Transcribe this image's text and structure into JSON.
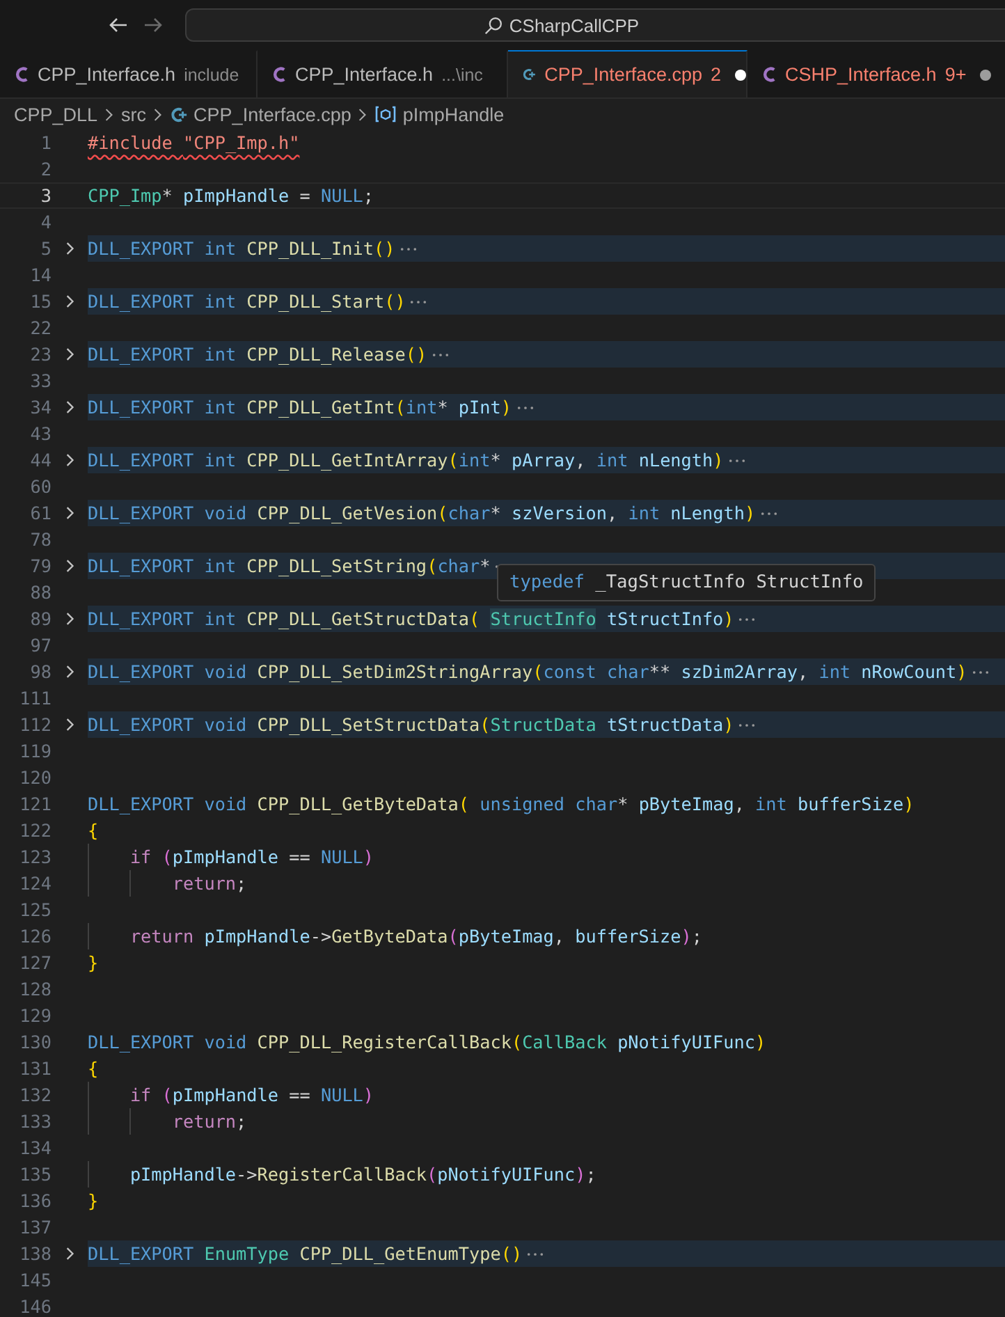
{
  "title_bar": {
    "back": {
      "disabled": false
    },
    "forward": {
      "disabled": true
    },
    "search": "CSharpCallCPP"
  },
  "tabs": [
    {
      "kind": "c",
      "label": "CPP_Interface.h",
      "detail": "include",
      "selected": false,
      "error": false,
      "modified": false
    },
    {
      "kind": "c",
      "label": "CPP_Interface.h",
      "detail": "...\\inc",
      "selected": false,
      "error": false,
      "modified": false
    },
    {
      "kind": "cpp",
      "label": "CPP_Interface.cpp",
      "badge": "2",
      "selected": true,
      "error": true,
      "modified": true
    },
    {
      "kind": "c",
      "label": "CSHP_Interface.h",
      "badge": "9+",
      "selected": false,
      "error": true,
      "modified": true
    }
  ],
  "breadcrumb": [
    {
      "kind": "folder",
      "label": "CPP_DLL"
    },
    {
      "kind": "folder",
      "label": "src"
    },
    {
      "kind": "cpp",
      "label": "CPP_Interface.cpp"
    },
    {
      "kind": "variable",
      "label": "pImpHandle"
    }
  ],
  "lines": [
    {
      "n": "1",
      "current": false,
      "folded": false,
      "tokens": [
        {
          "t": "#include ",
          "kind": "directive-error"
        },
        {
          "t": "\"CPP_Imp.h\"",
          "kind": "string-error"
        }
      ]
    },
    {
      "n": "2",
      "current": false,
      "folded": false
    },
    {
      "n": "3",
      "current": true,
      "folded": false,
      "tokens": [
        {
          "t": "CPP_Imp",
          "kind": "type"
        },
        {
          "t": "* ",
          "kind": "punct"
        },
        {
          "t": "pImpHandle",
          "kind": "variable"
        },
        {
          "t": " = ",
          "kind": "punct"
        },
        {
          "t": "NULL",
          "kind": "keyword"
        },
        {
          "t": ";",
          "kind": "punct"
        }
      ]
    },
    {
      "n": "4",
      "current": false,
      "folded": false
    },
    {
      "n": "5",
      "current": false,
      "folded": true,
      "tokens": [
        {
          "t": "DLL_EXPORT ",
          "kind": "macro"
        },
        {
          "t": "int ",
          "kind": "keyword"
        },
        {
          "t": "CPP_DLL_Init",
          "kind": "function"
        },
        {
          "t": "()",
          "kind": "bracket"
        }
      ]
    },
    {
      "n": "14",
      "current": false,
      "folded": false
    },
    {
      "n": "15",
      "current": false,
      "folded": true,
      "tokens": [
        {
          "t": "DLL_EXPORT ",
          "kind": "macro"
        },
        {
          "t": "int ",
          "kind": "keyword"
        },
        {
          "t": "CPP_DLL_Start",
          "kind": "function"
        },
        {
          "t": "()",
          "kind": "bracket"
        }
      ]
    },
    {
      "n": "22",
      "current": false,
      "folded": false
    },
    {
      "n": "23",
      "current": false,
      "folded": true,
      "tokens": [
        {
          "t": "DLL_EXPORT ",
          "kind": "macro"
        },
        {
          "t": "int ",
          "kind": "keyword"
        },
        {
          "t": "CPP_DLL_Release",
          "kind": "function"
        },
        {
          "t": "()",
          "kind": "bracket"
        }
      ]
    },
    {
      "n": "33",
      "current": false,
      "folded": false
    },
    {
      "n": "34",
      "current": false,
      "folded": true,
      "tokens": [
        {
          "t": "DLL_EXPORT ",
          "kind": "macro"
        },
        {
          "t": "int ",
          "kind": "keyword"
        },
        {
          "t": "CPP_DLL_GetInt",
          "kind": "function"
        },
        {
          "t": "(",
          "kind": "bracket"
        },
        {
          "t": "int",
          "kind": "keyword"
        },
        {
          "t": "* ",
          "kind": "punct"
        },
        {
          "t": "pInt",
          "kind": "variable"
        },
        {
          "t": ")",
          "kind": "bracket"
        }
      ]
    },
    {
      "n": "43",
      "current": false,
      "folded": false
    },
    {
      "n": "44",
      "current": false,
      "folded": true,
      "tokens": [
        {
          "t": "DLL_EXPORT ",
          "kind": "macro"
        },
        {
          "t": "int ",
          "kind": "keyword"
        },
        {
          "t": "CPP_DLL_GetIntArray",
          "kind": "function"
        },
        {
          "t": "(",
          "kind": "bracket"
        },
        {
          "t": "int",
          "kind": "keyword"
        },
        {
          "t": "* ",
          "kind": "punct"
        },
        {
          "t": "pArray",
          "kind": "variable"
        },
        {
          "t": ", ",
          "kind": "punct"
        },
        {
          "t": "int ",
          "kind": "keyword"
        },
        {
          "t": "nLength",
          "kind": "variable"
        },
        {
          "t": ")",
          "kind": "bracket"
        }
      ]
    },
    {
      "n": "60",
      "current": false,
      "folded": false
    },
    {
      "n": "61",
      "current": false,
      "folded": true,
      "tokens": [
        {
          "t": "DLL_EXPORT ",
          "kind": "macro"
        },
        {
          "t": "void ",
          "kind": "keyword"
        },
        {
          "t": "CPP_DLL_GetVesion",
          "kind": "function"
        },
        {
          "t": "(",
          "kind": "bracket"
        },
        {
          "t": "char",
          "kind": "keyword"
        },
        {
          "t": "* ",
          "kind": "punct"
        },
        {
          "t": "szVersion",
          "kind": "variable"
        },
        {
          "t": ", ",
          "kind": "punct"
        },
        {
          "t": "int ",
          "kind": "keyword"
        },
        {
          "t": "nLength",
          "kind": "variable"
        },
        {
          "t": ")",
          "kind": "bracket"
        }
      ]
    },
    {
      "n": "78",
      "current": false,
      "folded": false
    },
    {
      "n": "79",
      "current": false,
      "folded": true,
      "tokens": [
        {
          "t": "DLL_EXPORT ",
          "kind": "macro"
        },
        {
          "t": "int ",
          "kind": "keyword"
        },
        {
          "t": "CPP_DLL_SetString",
          "kind": "function"
        },
        {
          "t": "(",
          "kind": "bracket"
        },
        {
          "t": "char",
          "kind": "keyword"
        },
        {
          "t": "*",
          "kind": "punct"
        }
      ]
    },
    {
      "n": "88",
      "current": false,
      "folded": false
    },
    {
      "n": "89",
      "current": false,
      "folded": true,
      "tokens": [
        {
          "t": "DLL_EXPORT ",
          "kind": "macro"
        },
        {
          "t": "int ",
          "kind": "keyword"
        },
        {
          "t": "CPP_DLL_GetStructData",
          "kind": "function"
        },
        {
          "t": "( ",
          "kind": "bracket"
        },
        {
          "t": "StructInfo",
          "kind": "type-hover"
        },
        {
          "t": " tStructInfo",
          "kind": "variable"
        },
        {
          "t": ")",
          "kind": "bracket"
        }
      ]
    },
    {
      "n": "97",
      "current": false,
      "folded": false
    },
    {
      "n": "98",
      "current": false,
      "folded": true,
      "tokens": [
        {
          "t": "DLL_EXPORT ",
          "kind": "macro"
        },
        {
          "t": "void ",
          "kind": "keyword"
        },
        {
          "t": "CPP_DLL_SetDim2StringArray",
          "kind": "function"
        },
        {
          "t": "(",
          "kind": "bracket"
        },
        {
          "t": "const ",
          "kind": "keyword"
        },
        {
          "t": "char",
          "kind": "keyword"
        },
        {
          "t": "** ",
          "kind": "punct"
        },
        {
          "t": "szDim2Array",
          "kind": "variable"
        },
        {
          "t": ", ",
          "kind": "punct"
        },
        {
          "t": "int ",
          "kind": "keyword"
        },
        {
          "t": "nRowCount",
          "kind": "variable"
        },
        {
          "t": ")",
          "kind": "bracket"
        }
      ]
    },
    {
      "n": "111",
      "current": false,
      "folded": false
    },
    {
      "n": "112",
      "current": false,
      "folded": true,
      "tokens": [
        {
          "t": "DLL_EXPORT ",
          "kind": "macro"
        },
        {
          "t": "void ",
          "kind": "keyword"
        },
        {
          "t": "CPP_DLL_SetStructData",
          "kind": "function"
        },
        {
          "t": "(",
          "kind": "bracket"
        },
        {
          "t": "StructData",
          "kind": "type"
        },
        {
          "t": " tStructData",
          "kind": "variable"
        },
        {
          "t": ")",
          "kind": "bracket"
        }
      ]
    },
    {
      "n": "119",
      "current": false,
      "folded": false
    },
    {
      "n": "120",
      "current": false,
      "folded": false
    },
    {
      "n": "121",
      "current": false,
      "folded": false,
      "tokens": [
        {
          "t": "DLL_EXPORT ",
          "kind": "macro"
        },
        {
          "t": "void ",
          "kind": "keyword"
        },
        {
          "t": "CPP_DLL_GetByteData",
          "kind": "function"
        },
        {
          "t": "( ",
          "kind": "bracket"
        },
        {
          "t": "unsigned ",
          "kind": "keyword"
        },
        {
          "t": "char",
          "kind": "keyword"
        },
        {
          "t": "* ",
          "kind": "punct"
        },
        {
          "t": "pByteImag",
          "kind": "variable"
        },
        {
          "t": ", ",
          "kind": "punct"
        },
        {
          "t": "int ",
          "kind": "keyword"
        },
        {
          "t": "bufferSize",
          "kind": "variable"
        },
        {
          "t": ")",
          "kind": "bracket"
        }
      ]
    },
    {
      "n": "122",
      "current": false,
      "folded": false,
      "tokens": [
        {
          "t": "{",
          "kind": "bracket"
        }
      ]
    },
    {
      "n": "123",
      "current": false,
      "folded": false,
      "tokens": [
        {
          "t": "    if ",
          "kind": "control"
        },
        {
          "t": "(",
          "kind": "bracket2"
        },
        {
          "t": "pImpHandle",
          "kind": "variable"
        },
        {
          "t": " == ",
          "kind": "punct"
        },
        {
          "t": "NULL",
          "kind": "keyword"
        },
        {
          "t": ")",
          "kind": "bracket2"
        }
      ]
    },
    {
      "n": "124",
      "current": false,
      "folded": false,
      "tokens": [
        {
          "t": "        return",
          "kind": "control"
        },
        {
          "t": ";",
          "kind": "punct"
        }
      ]
    },
    {
      "n": "125",
      "current": false,
      "folded": false
    },
    {
      "n": "126",
      "current": false,
      "folded": false,
      "tokens": [
        {
          "t": "    return ",
          "kind": "control"
        },
        {
          "t": "pImpHandle",
          "kind": "variable"
        },
        {
          "t": "->",
          "kind": "punct"
        },
        {
          "t": "GetByteData",
          "kind": "function"
        },
        {
          "t": "(",
          "kind": "bracket2"
        },
        {
          "t": "pByteImag",
          "kind": "variable"
        },
        {
          "t": ", ",
          "kind": "punct"
        },
        {
          "t": "bufferSize",
          "kind": "variable"
        },
        {
          "t": ")",
          "kind": "bracket2"
        },
        {
          "t": ";",
          "kind": "punct"
        }
      ]
    },
    {
      "n": "127",
      "current": false,
      "folded": false,
      "tokens": [
        {
          "t": "}",
          "kind": "bracket"
        }
      ]
    },
    {
      "n": "128",
      "current": false,
      "folded": false
    },
    {
      "n": "129",
      "current": false,
      "folded": false
    },
    {
      "n": "130",
      "current": false,
      "folded": false,
      "tokens": [
        {
          "t": "DLL_EXPORT ",
          "kind": "macro"
        },
        {
          "t": "void ",
          "kind": "keyword"
        },
        {
          "t": "CPP_DLL_RegisterCallBack",
          "kind": "function"
        },
        {
          "t": "(",
          "kind": "bracket"
        },
        {
          "t": "CallBack",
          "kind": "type"
        },
        {
          "t": " pNotifyUIFunc",
          "kind": "variable"
        },
        {
          "t": ")",
          "kind": "bracket"
        }
      ]
    },
    {
      "n": "131",
      "current": false,
      "folded": false,
      "tokens": [
        {
          "t": "{",
          "kind": "bracket"
        }
      ]
    },
    {
      "n": "132",
      "current": false,
      "folded": false,
      "tokens": [
        {
          "t": "    if ",
          "kind": "control"
        },
        {
          "t": "(",
          "kind": "bracket2"
        },
        {
          "t": "pImpHandle",
          "kind": "variable"
        },
        {
          "t": " == ",
          "kind": "punct"
        },
        {
          "t": "NULL",
          "kind": "keyword"
        },
        {
          "t": ")",
          "kind": "bracket2"
        }
      ]
    },
    {
      "n": "133",
      "current": false,
      "folded": false,
      "tokens": [
        {
          "t": "        return",
          "kind": "control"
        },
        {
          "t": ";",
          "kind": "punct"
        }
      ]
    },
    {
      "n": "134",
      "current": false,
      "folded": false
    },
    {
      "n": "135",
      "current": false,
      "folded": false,
      "tokens": [
        {
          "t": "    pImpHandle",
          "kind": "variable"
        },
        {
          "t": "->",
          "kind": "punct"
        },
        {
          "t": "RegisterCallBack",
          "kind": "function"
        },
        {
          "t": "(",
          "kind": "bracket2"
        },
        {
          "t": "pNotifyUIFunc",
          "kind": "variable"
        },
        {
          "t": ")",
          "kind": "bracket2"
        },
        {
          "t": ";",
          "kind": "punct"
        }
      ]
    },
    {
      "n": "136",
      "current": false,
      "folded": false,
      "tokens": [
        {
          "t": "}",
          "kind": "bracket"
        }
      ]
    },
    {
      "n": "137",
      "current": false,
      "folded": false
    },
    {
      "n": "138",
      "current": false,
      "folded": true,
      "tokens": [
        {
          "t": "DLL_EXPORT ",
          "kind": "macro"
        },
        {
          "t": "EnumType ",
          "kind": "type"
        },
        {
          "t": "CPP_DLL_GetEnumType",
          "kind": "function"
        },
        {
          "t": "()",
          "kind": "bracket"
        }
      ]
    },
    {
      "n": "145",
      "current": false,
      "folded": false
    },
    {
      "n": "146",
      "current": false,
      "folded": false
    }
  ],
  "hover_tooltip": {
    "tokens": [
      {
        "t": "typedef",
        "kind": "keyword"
      },
      {
        "t": " _TagStructInfo StructInfo",
        "kind": "punct"
      }
    ]
  }
}
